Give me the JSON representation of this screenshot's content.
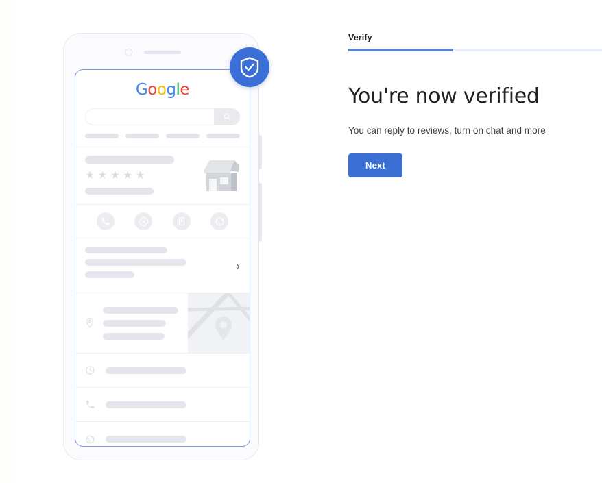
{
  "theme": {
    "accent_blue": "#3b6fd4",
    "badge_blue": "#3a6fd8",
    "progress_fill": "#5a81d1",
    "progress_track": "#e8eef7",
    "placeholder_gray": "#e4e6eb",
    "text_primary": "#202124"
  },
  "panel": {
    "step_label": "Verify",
    "progress_percent": 41,
    "headline": "You're now verified",
    "subtext": "You can reply to reviews, turn on chat and more",
    "next_label": "Next"
  },
  "phone": {
    "badge_icon": "shield-check-icon",
    "camera_icon": "front-camera-icon",
    "speaker_icon": "earpiece-speaker-icon",
    "power_button": "power-button",
    "volume_button": "volume-button",
    "screen": {
      "brand": {
        "name": "Google",
        "letters": [
          {
            "char": "G",
            "color": "#4285f4"
          },
          {
            "char": "o",
            "color": "#ea4335"
          },
          {
            "char": "o",
            "color": "#fbbc05"
          },
          {
            "char": "g",
            "color": "#4285f4"
          },
          {
            "char": "l",
            "color": "#34a853"
          },
          {
            "char": "e",
            "color": "#ea4335"
          }
        ]
      },
      "search": {
        "placeholder": "",
        "value": "",
        "icon": "search-icon"
      },
      "chips": [
        "",
        "",
        "",
        ""
      ],
      "business_card": {
        "title_placeholder": "",
        "rating_stars": 5,
        "star_glyph": "★",
        "subtitle_placeholder": "",
        "thumbnail_icon": "storefront-icon"
      },
      "action_buttons": [
        {
          "name": "call",
          "icon": "phone-icon"
        },
        {
          "name": "directions",
          "icon": "directions-icon"
        },
        {
          "name": "save",
          "icon": "bookmark-icon"
        },
        {
          "name": "website",
          "icon": "globe-icon"
        }
      ],
      "detail_block": {
        "lines": [
          "",
          "",
          ""
        ],
        "chevron_icon": "chevron-right-icon",
        "chevron_glyph": "›"
      },
      "info_rows": [
        {
          "name": "address",
          "icon": "location-pin-icon",
          "lines": [
            "",
            "",
            ""
          ],
          "has_map": true,
          "map_icon": "map-thumbnail"
        },
        {
          "name": "hours",
          "icon": "clock-icon",
          "lines": [
            ""
          ],
          "has_map": false
        },
        {
          "name": "phone",
          "icon": "phone-handset-icon",
          "lines": [
            ""
          ],
          "has_map": false
        },
        {
          "name": "website",
          "icon": "globe-icon",
          "lines": [
            ""
          ],
          "has_map": false
        }
      ]
    }
  }
}
